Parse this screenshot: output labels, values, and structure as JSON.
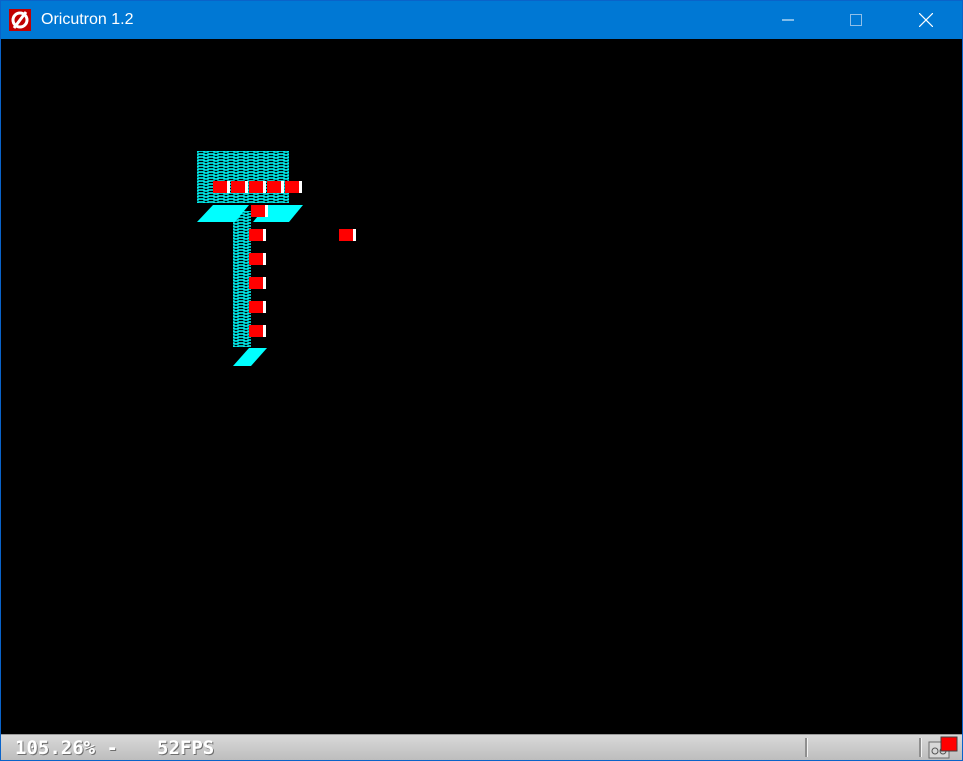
{
  "window": {
    "title": "Oricutron 1.2",
    "accent_color": "#0078d4",
    "icons": {
      "app": "oricutron-logo-icon",
      "minimize": "minimize-icon",
      "maximize": "maximize-icon",
      "close": "close-icon"
    }
  },
  "screen": {
    "background_color": "#000000",
    "graphic_colors": {
      "primary": "#00ffff",
      "secondary": "#ff0000",
      "highlight": "#ffffff"
    },
    "graphic": "oric-hires-game-graphic"
  },
  "statusbar": {
    "speed_text": "105.26% -",
    "fps_text": "52FPS",
    "icons": {
      "tape": "tape-status-icon"
    }
  }
}
